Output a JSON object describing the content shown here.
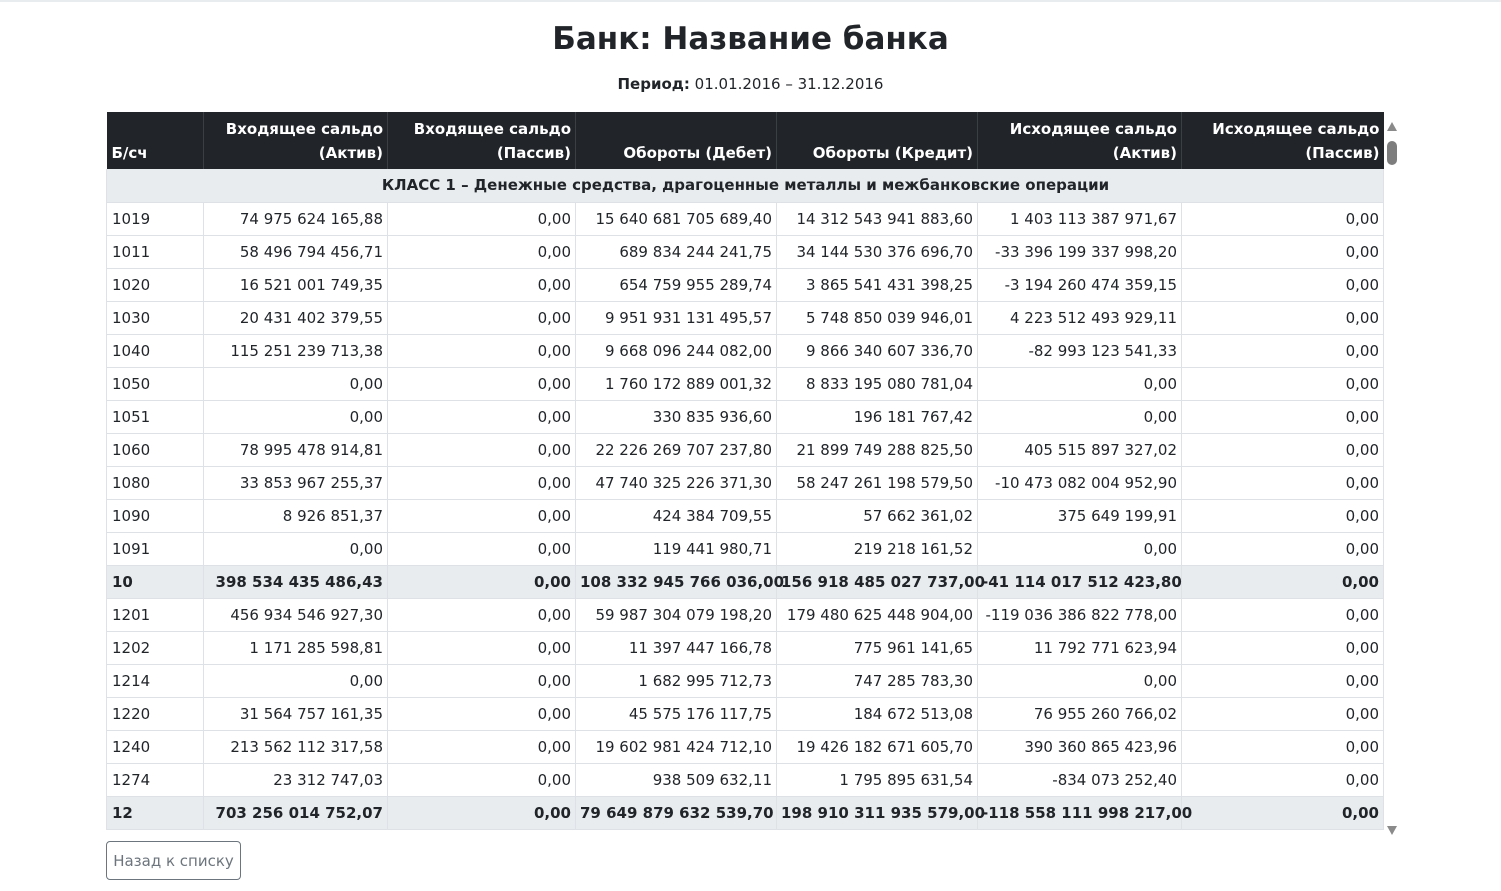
{
  "title": "Банк: Название банка",
  "period": {
    "label": "Период:",
    "value": " 01.01.2016 – 31.12.2016"
  },
  "table": {
    "headers": [
      {
        "line1": "Б/сч",
        "line2": ""
      },
      {
        "line1": "Входящее сальдо",
        "line2": "(Актив)"
      },
      {
        "line1": "Входящее сальдо",
        "line2": "(Пассив)"
      },
      {
        "line1": "",
        "line2": "Обороты (Дебет)"
      },
      {
        "line1": "",
        "line2": "Обороты (Кредит)"
      },
      {
        "line1": "Исходящее сальдо",
        "line2": "(Актив)"
      },
      {
        "line1": "Исходящее сальдо",
        "line2": "(Пассив)"
      }
    ],
    "class_title": "КЛАСС 1 – Денежные средства, драгоценные металлы и межбанковские операции",
    "rows": [
      {
        "type": "row",
        "cells": [
          "1019",
          "74 975 624 165,88",
          "0,00",
          "15 640 681 705 689,40",
          "14 312 543 941 883,60",
          "1 403 113 387 971,67",
          "0,00"
        ]
      },
      {
        "type": "row",
        "cells": [
          "1011",
          "58 496 794 456,71",
          "0,00",
          "689 834 244 241,75",
          "34 144 530 376 696,70",
          "-33 396 199 337 998,20",
          "0,00"
        ]
      },
      {
        "type": "row",
        "cells": [
          "1020",
          "16 521 001 749,35",
          "0,00",
          "654 759 955 289,74",
          "3 865 541 431 398,25",
          "-3 194 260 474 359,15",
          "0,00"
        ]
      },
      {
        "type": "row",
        "cells": [
          "1030",
          "20 431 402 379,55",
          "0,00",
          "9 951 931 131 495,57",
          "5 748 850 039 946,01",
          "4 223 512 493 929,11",
          "0,00"
        ]
      },
      {
        "type": "row",
        "cells": [
          "1040",
          "115 251 239 713,38",
          "0,00",
          "9 668 096 244 082,00",
          "9 866 340 607 336,70",
          "-82 993 123 541,33",
          "0,00"
        ]
      },
      {
        "type": "row",
        "cells": [
          "1050",
          "0,00",
          "0,00",
          "1 760 172 889 001,32",
          "8 833 195 080 781,04",
          "0,00",
          "0,00"
        ]
      },
      {
        "type": "row",
        "cells": [
          "1051",
          "0,00",
          "0,00",
          "330 835 936,60",
          "196 181 767,42",
          "0,00",
          "0,00"
        ]
      },
      {
        "type": "row",
        "cells": [
          "1060",
          "78 995 478 914,81",
          "0,00",
          "22 226 269 707 237,80",
          "21 899 749 288 825,50",
          "405 515 897 327,02",
          "0,00"
        ]
      },
      {
        "type": "row",
        "cells": [
          "1080",
          "33 853 967 255,37",
          "0,00",
          "47 740 325 226 371,30",
          "58 247 261 198 579,50",
          "-10 473 082 004 952,90",
          "0,00"
        ]
      },
      {
        "type": "row",
        "cells": [
          "1090",
          "8 926 851,37",
          "0,00",
          "424 384 709,55",
          "57 662 361,02",
          "375 649 199,91",
          "0,00"
        ]
      },
      {
        "type": "row",
        "cells": [
          "1091",
          "0,00",
          "0,00",
          "119 441 980,71",
          "219 218 161,52",
          "0,00",
          "0,00"
        ]
      },
      {
        "type": "subtotal",
        "cells": [
          "10",
          "398 534 435 486,43",
          "0,00",
          "108 332 945 766 036,00",
          "156 918 485 027 737,00",
          "-41 114 017 512 423,80",
          "0,00"
        ]
      },
      {
        "type": "row",
        "cells": [
          "1201",
          "456 934 546 927,30",
          "0,00",
          "59 987 304 079 198,20",
          "179 480 625 448 904,00",
          "-119 036 386 822 778,00",
          "0,00"
        ]
      },
      {
        "type": "row",
        "cells": [
          "1202",
          "1 171 285 598,81",
          "0,00",
          "11 397 447 166,78",
          "775 961 141,65",
          "11 792 771 623,94",
          "0,00"
        ]
      },
      {
        "type": "row",
        "cells": [
          "1214",
          "0,00",
          "0,00",
          "1 682 995 712,73",
          "747 285 783,30",
          "0,00",
          "0,00"
        ]
      },
      {
        "type": "row",
        "cells": [
          "1220",
          "31 564 757 161,35",
          "0,00",
          "45 575 176 117,75",
          "184 672 513,08",
          "76 955 260 766,02",
          "0,00"
        ]
      },
      {
        "type": "row",
        "cells": [
          "1240",
          "213 562 112 317,58",
          "0,00",
          "19 602 981 424 712,10",
          "19 426 182 671 605,70",
          "390 360 865 423,96",
          "0,00"
        ]
      },
      {
        "type": "row",
        "cells": [
          "1274",
          "23 312 747,03",
          "0,00",
          "938 509 632,11",
          "1 795 895 631,54",
          "-834 073 252,40",
          "0,00"
        ]
      },
      {
        "type": "subtotal",
        "cells": [
          "12",
          "703 256 014 752,07",
          "0,00",
          "79 649 879 632 539,70",
          "198 910 311 935 579,00",
          "-118 558 111 998 217,00",
          "0,00"
        ]
      }
    ]
  },
  "back_button": "Назад к списку",
  "colors": {
    "header_bg": "#212529",
    "stripe_bg": "#e9ecef",
    "border": "#dee2e6",
    "button_border": "#6c757d"
  },
  "icons": {
    "scroll_up": "triangle-up-icon",
    "scroll_down": "triangle-down-icon"
  }
}
